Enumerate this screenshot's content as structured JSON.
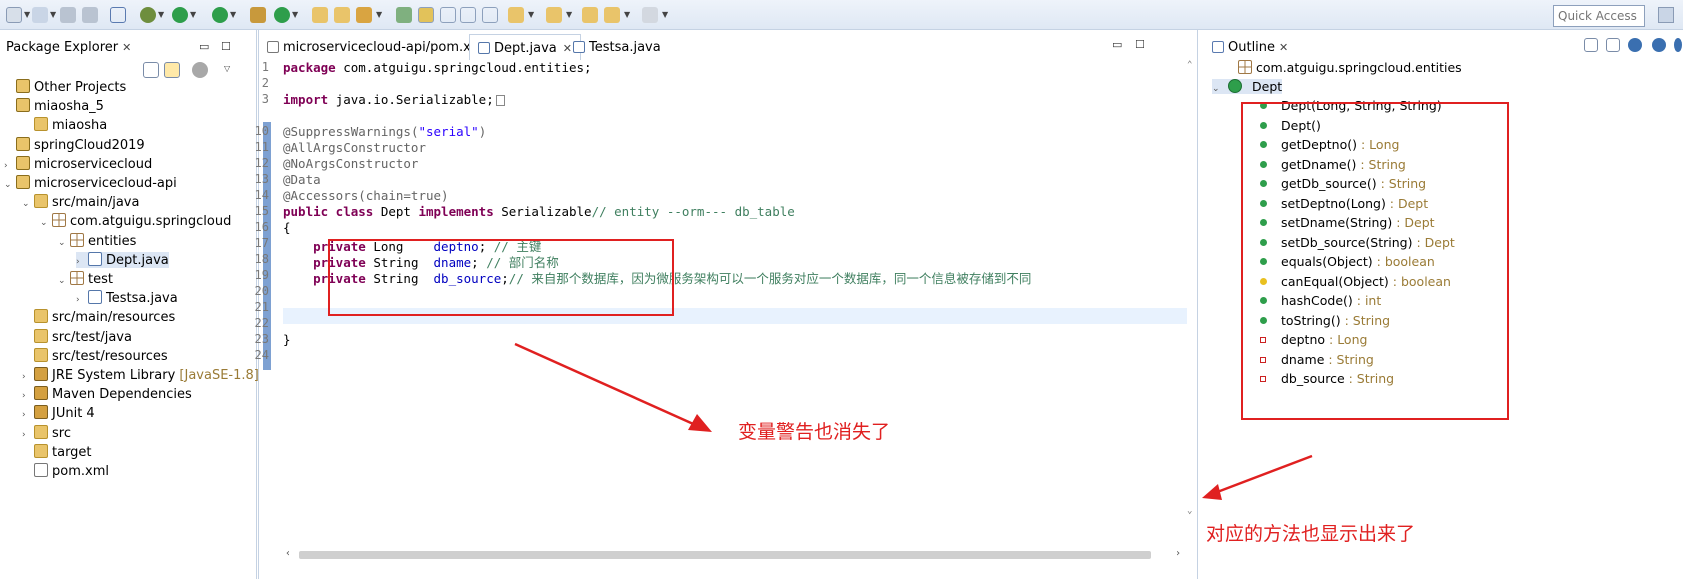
{
  "toolbar": {
    "quick_access_placeholder": "Quick Access"
  },
  "package_explorer": {
    "title": "Package Explorer",
    "tree": [
      {
        "label": "Other Projects",
        "icon": "working-set-icon"
      },
      {
        "label": "miaosha_5",
        "icon": "project-icon"
      },
      {
        "label": "miaosha",
        "icon": "folder-icon"
      },
      {
        "label": "springCloud2019",
        "icon": "project-icon"
      },
      {
        "label": "microservicecloud",
        "icon": "project-icon"
      },
      {
        "label": "microservicecloud-api",
        "icon": "project-icon"
      },
      {
        "label": "src/main/java",
        "icon": "source-folder-icon"
      },
      {
        "label": "com.atguigu.springcloud",
        "icon": "package-icon"
      },
      {
        "label": "entities",
        "icon": "package-icon"
      },
      {
        "label": "Dept.java",
        "icon": "java-file-icon"
      },
      {
        "label": "test",
        "icon": "package-icon"
      },
      {
        "label": "Testsa.java",
        "icon": "java-file-icon"
      },
      {
        "label": "src/main/resources",
        "icon": "source-folder-icon"
      },
      {
        "label": "src/test/java",
        "icon": "source-folder-icon"
      },
      {
        "label": "src/test/resources",
        "icon": "source-folder-icon"
      },
      {
        "label": "JRE System Library",
        "extra": "[JavaSE-1.8]",
        "icon": "library-icon"
      },
      {
        "label": "Maven Dependencies",
        "icon": "library-icon"
      },
      {
        "label": "JUnit 4",
        "icon": "library-icon"
      },
      {
        "label": "src",
        "icon": "folder-icon"
      },
      {
        "label": "target",
        "icon": "folder-icon"
      },
      {
        "label": "pom.xml",
        "icon": "xml-file-icon"
      }
    ]
  },
  "editor": {
    "tabs": [
      {
        "label": "microservicecloud-api/pom.xml"
      },
      {
        "label": "Dept.java"
      },
      {
        "label": "Testsa.java"
      }
    ],
    "line_numbers": [
      "1",
      "2",
      "3",
      "10",
      "11",
      "12",
      "13",
      "14",
      "15",
      "16",
      "17",
      "18",
      "19",
      "20",
      "21",
      "22",
      "23",
      "24"
    ],
    "code": {
      "l1": "package com.atguigu.springcloud.entities;",
      "l3": "import java.io.Serializable;",
      "l10": "@SuppressWarnings",
      "l10_str": "\"serial\"",
      "l11": "@AllArgsConstructor",
      "l12": "@NoArgsConstructor",
      "l13": "@Data",
      "l14": "@Accessors(chain=true)",
      "l15_kw": "public class",
      "l15_name": " Dept ",
      "l15_kw2": "implements",
      "l15_rest": " Serializable",
      "l15_cm": "// entity --orm--- db_table",
      "l16": "{",
      "l17_type": " Long    ",
      "l17_field": "deptno",
      "l17_cm": "// 主键",
      "l18_type": " String  ",
      "l18_field": "dname",
      "l18_cm": "// 部门名称",
      "l19_type": " String  ",
      "l19_field": "db_source",
      "l19_cm": "// 来自那个数据库，因为微服务架构可以一个服务对应一个数据库，同一个信息被存储到不同",
      "private_kw": "private",
      "l23": "}"
    }
  },
  "outline": {
    "title": "Outline",
    "package": "com.atguigu.springcloud.entities",
    "class": "Dept",
    "members": [
      {
        "name": "Dept(Long, String, String)",
        "type": "",
        "kind": "constructor"
      },
      {
        "name": "Dept()",
        "type": "",
        "kind": "constructor"
      },
      {
        "name": "getDeptno()",
        "type": " : Long",
        "kind": "method"
      },
      {
        "name": "getDname()",
        "type": " : String",
        "kind": "method"
      },
      {
        "name": "getDb_source()",
        "type": " : String",
        "kind": "method"
      },
      {
        "name": "setDeptno(Long)",
        "type": " : Dept",
        "kind": "method"
      },
      {
        "name": "setDname(String)",
        "type": " : Dept",
        "kind": "method"
      },
      {
        "name": "setDb_source(String)",
        "type": " : Dept",
        "kind": "method"
      },
      {
        "name": "equals(Object)",
        "type": " : boolean",
        "kind": "override"
      },
      {
        "name": "canEqual(Object)",
        "type": " : boolean",
        "kind": "protected"
      },
      {
        "name": "hashCode()",
        "type": " : int",
        "kind": "override"
      },
      {
        "name": "toString()",
        "type": " : String",
        "kind": "override"
      },
      {
        "name": "deptno",
        "type": " : Long",
        "kind": "field"
      },
      {
        "name": "dname",
        "type": " : String",
        "kind": "field"
      },
      {
        "name": "db_source",
        "type": " : String",
        "kind": "field"
      }
    ]
  },
  "annotations": {
    "warning_gone": "变量警告也消失了",
    "methods_shown": "对应的方法也显示出来了"
  },
  "colors": {
    "annotation_red": "#e02020",
    "accent": "#7ea1d2"
  }
}
